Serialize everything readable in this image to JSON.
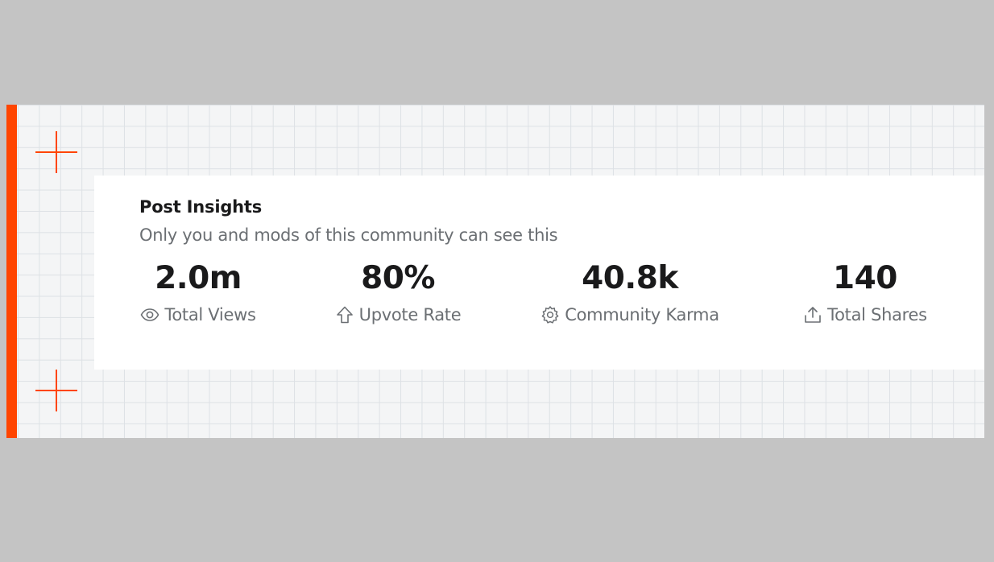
{
  "insights": {
    "title": "Post Insights",
    "subtitle": "Only you and mods of this community can see this",
    "stats": [
      {
        "value": "2.0m",
        "label": "Total Views",
        "icon": "eye-icon"
      },
      {
        "value": "80%",
        "label": "Upvote Rate",
        "icon": "upvote-arrow-icon"
      },
      {
        "value": "40.8k",
        "label": "Community Karma",
        "icon": "karma-gear-icon"
      },
      {
        "value": "140",
        "label": "Total Shares",
        "icon": "share-icon"
      }
    ]
  },
  "colors": {
    "accent": "#ff4500",
    "text_primary": "#1a1a1b",
    "text_secondary": "#6b6f73",
    "card_background": "#ffffff",
    "canvas_background": "#f4f5f6"
  }
}
